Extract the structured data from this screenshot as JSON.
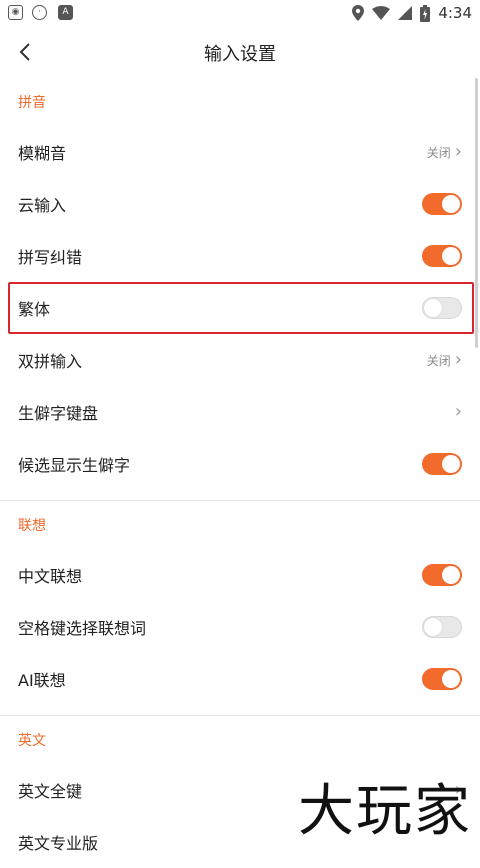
{
  "status_bar": {
    "time": "4:34",
    "icons": [
      "baidu-icon",
      "pet-icon",
      "a-icon",
      "location-icon",
      "wifi-icon",
      "signal-icon",
      "battery-icon"
    ]
  },
  "header": {
    "title": "输入设置",
    "back_icon": "chevron-left-icon"
  },
  "sections": {
    "pinyin": {
      "title": "拼音",
      "items": [
        {
          "label": "模糊音",
          "value": "关闭",
          "control": "link"
        },
        {
          "label": "云输入",
          "control": "switch",
          "on": true
        },
        {
          "label": "拼写纠错",
          "control": "switch",
          "on": true
        },
        {
          "label": "繁体",
          "control": "switch",
          "on": false,
          "highlighted": true
        },
        {
          "label": "双拼输入",
          "value": "关闭",
          "control": "link"
        },
        {
          "label": "生僻字键盘",
          "control": "link"
        },
        {
          "label": "候选显示生僻字",
          "control": "switch",
          "on": true
        }
      ]
    },
    "association": {
      "title": "联想",
      "items": [
        {
          "label": "中文联想",
          "control": "switch",
          "on": true
        },
        {
          "label": "空格键选择联想词",
          "control": "switch",
          "on": false
        },
        {
          "label": "AI联想",
          "control": "switch",
          "on": true
        }
      ]
    },
    "english": {
      "title": "英文",
      "items": [
        {
          "label": "英文全键",
          "control": "link"
        },
        {
          "label": "英文专业版",
          "control": "link"
        }
      ]
    }
  },
  "watermark": "大玩家",
  "colors": {
    "accent": "#f26a2c",
    "section_title": "#ef6a2c",
    "highlight": "#d9262c"
  }
}
